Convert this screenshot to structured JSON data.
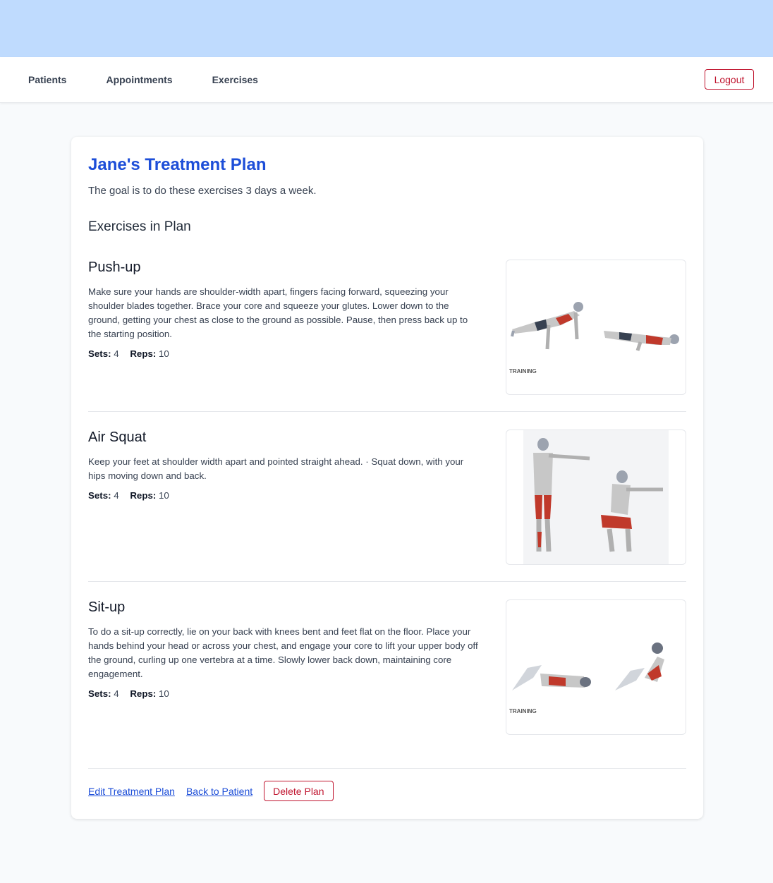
{
  "nav": {
    "links": [
      "Patients",
      "Appointments",
      "Exercises"
    ],
    "logout_label": "Logout"
  },
  "plan": {
    "title": "Jane's Treatment Plan",
    "goal": "The goal is to do these exercises 3 days a week.",
    "section_title": "Exercises in Plan",
    "exercises": [
      {
        "name": "Push-up",
        "description": "Make sure your hands are shoulder-width apart, fingers facing forward, squeezing your shoulder blades together. Brace your core and squeeze your glutes. Lower down to the ground, getting your chest as close to the ground as possible. Pause, then press back up to the starting position.",
        "sets_label": "Sets:",
        "sets": "4",
        "reps_label": "Reps:",
        "reps": "10",
        "image_mark": "TRAINING",
        "image_icon": "push-up-illustration"
      },
      {
        "name": "Air Squat",
        "description": "Keep your feet at shoulder width apart and pointed straight ahead. · Squat down, with your hips moving down and back.",
        "sets_label": "Sets:",
        "sets": "4",
        "reps_label": "Reps:",
        "reps": "10",
        "image_icon": "squat-illustration"
      },
      {
        "name": "Sit-up",
        "description": "To do a sit-up correctly, lie on your back with knees bent and feet flat on the floor. Place your hands behind your head or across your chest, and engage your core to lift your upper body off the ground, curling up one vertebra at a time. Slowly lower back down, maintaining core engagement.",
        "sets_label": "Sets:",
        "sets": "4",
        "reps_label": "Reps:",
        "reps": "10",
        "image_mark": "TRAINING",
        "image_icon": "sit-up-illustration"
      }
    ]
  },
  "actions": {
    "edit_label": "Edit Treatment Plan",
    "back_label": "Back to Patient",
    "delete_label": "Delete Plan"
  },
  "colors": {
    "top_band": "#bfdbfe",
    "title_blue": "#1d4ed8",
    "danger_red": "#c0152f",
    "muscle_red": "#c0392b"
  }
}
